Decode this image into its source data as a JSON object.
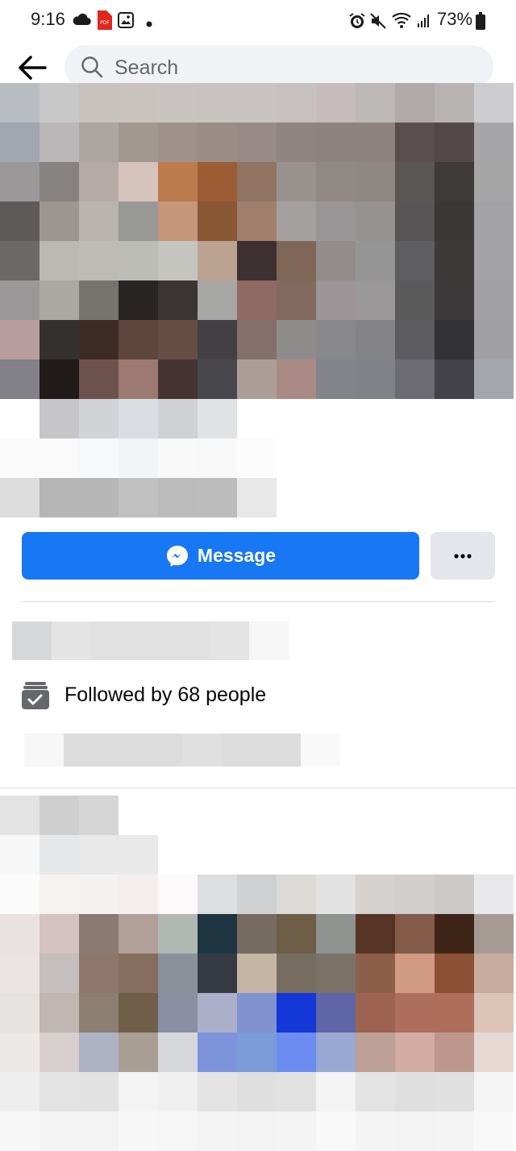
{
  "status_bar": {
    "time": "9:16",
    "battery": "73%",
    "icons_left": [
      "cloud-icon",
      "pdf-icon",
      "gallery-icon",
      "dot-icon"
    ],
    "icons_right": [
      "alarm-icon",
      "mute-icon",
      "wifi-icon",
      "signal-icon",
      "battery-icon"
    ]
  },
  "nav": {
    "search_placeholder": "Search"
  },
  "actions": {
    "message_label": "Message",
    "more_label": "•••"
  },
  "info": {
    "followed_text": "Followed by 68 people"
  },
  "colors": {
    "accent": "#1877f2",
    "secondary_button": "#e4e6eb",
    "search_bg": "#f0f2f5"
  },
  "mosaics": {
    "header": [
      [
        "#b9bcc1",
        "#c9c8c8",
        "#c7c2be",
        "#c9c2bf",
        "#c9c3c1",
        "#c8c3c1",
        "#c8c3c2",
        "#c6c0c0",
        "#c6bcbc",
        "#bdb8b8",
        "#b0abaa",
        "#b7b3b3",
        "#cdcdcf"
      ],
      [
        "#a2a6ae",
        "#bbb7b8",
        "#ada5a2",
        "#a39791",
        "#9f928c",
        "#9a8d88",
        "#978a87",
        "#908480",
        "#8e837f",
        "#8e8380",
        "#5a4f4e",
        "#524848",
        "#a5a4a6"
      ],
      [
        "#9a9899",
        "#868281",
        "#b6aaa7",
        "#d6c3bb",
        "#bb7b4d",
        "#9c5c34",
        "#917464",
        "#999390",
        "#908884",
        "#8e8884",
        "#5a5654",
        "#3f3a3a",
        "#a5a5a6"
      ],
      [
        "#5f5a5a",
        "#9c9693",
        "#bab4ae",
        "#989895",
        "#c5967a",
        "#8a5835",
        "#a0806d",
        "#a4a0a0",
        "#999495",
        "#969291",
        "#575556",
        "#3c3838",
        "#a3a3a5"
      ],
      [
        "#6d6968",
        "#bab9b3",
        "#bcbcb4",
        "#bdbdb7",
        "#c5c5bf",
        "#bca291",
        "#3c3130",
        "#806656",
        "#928c8a",
        "#959595",
        "#5e5e60",
        "#3c3939",
        "#a3a3a6"
      ],
      [
        "#9a9899",
        "#a9a8a2",
        "#77746f",
        "#292525",
        "#3b3434",
        "#a6a6a4",
        "#8e6a63",
        "#836a60",
        "#9c9496",
        "#9a9899",
        "#5a5a5b",
        "#3b3939",
        "#a1a1a6"
      ],
      [
        "#b89c9e",
        "#353030",
        "#3f2b26",
        "#5e463c",
        "#654d43",
        "#424042",
        "#856f6a",
        "#8f8c8c",
        "#88878a",
        "#848487",
        "#5d5c60",
        "#333234",
        "#a09fa3"
      ],
      [
        "#818187",
        "#211b1c",
        "#6d524c",
        "#9d7a71",
        "#453433",
        "#48474c",
        "#ad9f97",
        "#a98a84",
        "#83838a",
        "#818188",
        "#6c6c72",
        "#434248",
        "#a3a7ad"
      ],
      [
        "#ffffff",
        "#c6c6c8",
        "#d1d3d7",
        "#dadde1",
        "#cfd1d5",
        "#e1e2e4",
        "#ffffff",
        "#ffffff",
        "#ffffff",
        "#ffffff",
        "#ffffff",
        "#ffffff",
        "#ffffff"
      ],
      [
        "#fbfbfb",
        "#fafafa",
        "#f7f8f9",
        "#f2f3f5",
        "#f9f9fa",
        "#f8f8f8",
        "#fcfcfc",
        "#ffffff",
        "#ffffff",
        "#ffffff",
        "#ffffff",
        "#ffffff",
        "#ffffff"
      ],
      [
        "#dcdcdc",
        "#b6b6b6",
        "#b7b7b7",
        "#c0c0c0",
        "#bbbbbb",
        "#bcbcbc",
        "#e8e8e8",
        "#ffffff",
        "#ffffff",
        "#ffffff",
        "#ffffff",
        "#ffffff",
        "#ffffff"
      ]
    ],
    "name_bar": [
      [
        "#d7d8da",
        "#e4e4e5",
        "#e1e1e1",
        "#e1e1e1",
        "#e1e1e1",
        "#e3e3e3",
        "#f6f6f6"
      ]
    ],
    "sub_bar": [
      [
        "#f6f6f6",
        "#dcdcdc",
        "#dcdcdc",
        "#dcdcdc",
        "#e0e0e0",
        "#dcdcdc",
        "#dcdcdc",
        "#f9f9f9"
      ]
    ],
    "bottom": [
      [
        "#e3e3e3",
        "#cfcfcf",
        "#d5d5d5",
        "#ffffff",
        "#ffffff",
        "#ffffff",
        "#ffffff",
        "#ffffff",
        "#ffffff",
        "#ffffff",
        "#ffffff",
        "#ffffff",
        "#ffffff"
      ],
      [
        "#f7f7f7",
        "#e6e7e8",
        "#e8e8e9",
        "#e9e9ea",
        "#ffffff",
        "#ffffff",
        "#ffffff",
        "#ffffff",
        "#ffffff",
        "#ffffff",
        "#ffffff",
        "#ffffff",
        "#ffffff"
      ],
      [
        "#fbfbfb",
        "#f6f2f2",
        "#f4f1f1",
        "#f3eded",
        "#fbf9f9",
        "#dddee0",
        "#cfd0d2",
        "#dbdad6",
        "#e2e2e2",
        "#d5d1ce",
        "#d2cecb",
        "#cdc9c7",
        "#e8e8ea"
      ],
      [
        "#eae2e2",
        "#d4c3c2",
        "#8b7972",
        "#b0a098",
        "#b1b7b3",
        "#1f3441",
        "#766b61",
        "#6e5e47",
        "#8f938f",
        "#573526",
        "#855b4a",
        "#3f2518",
        "#a69b94"
      ],
      [
        "#ebe3e4",
        "#c6bdbd",
        "#8e776a",
        "#866e5e",
        "#8a9198",
        "#353a44",
        "#c5b5a5",
        "#766d60",
        "#7a7267",
        "#8d5f4a",
        "#d19a85",
        "#8a5135",
        "#c7ac9d"
      ],
      [
        "#e5e2df",
        "#c0b6b3",
        "#8c7e70",
        "#705e49",
        "#8a8ea2",
        "#abafc9",
        "#8093ce",
        "#1437d8",
        "#5e66a8",
        "#9e6250",
        "#ad6e5d",
        "#ad6e5c",
        "#dbc3b6"
      ],
      [
        "#ece8e5",
        "#d8d0ce",
        "#aeb1c3",
        "#a99e94",
        "#d6d7db",
        "#7d93dc",
        "#7b9bd9",
        "#6b8cf0",
        "#9aa9d3",
        "#bda096",
        "#d4aca1",
        "#bd978b",
        "#e6d9d3"
      ],
      [
        "#eeeeee",
        "#e3e3e3",
        "#e2e2e2",
        "#f3f3f3",
        "#f0f0f0",
        "#e4e4e4",
        "#dfdfdf",
        "#e1e1e1",
        "#f3f3f3",
        "#e3e3e3",
        "#dfdfdf",
        "#e0e0e0",
        "#f5f5f5"
      ],
      [
        "#f7f7f7",
        "#f4f4f4",
        "#f3f3f3",
        "#f7f7f7",
        "#f6f6f6",
        "#f4f4f4",
        "#f3f3f3",
        "#f4f4f4",
        "#f8f8f8",
        "#f4f4f4",
        "#f3f3f3",
        "#f4f4f4",
        "#f8f8f8"
      ]
    ]
  }
}
